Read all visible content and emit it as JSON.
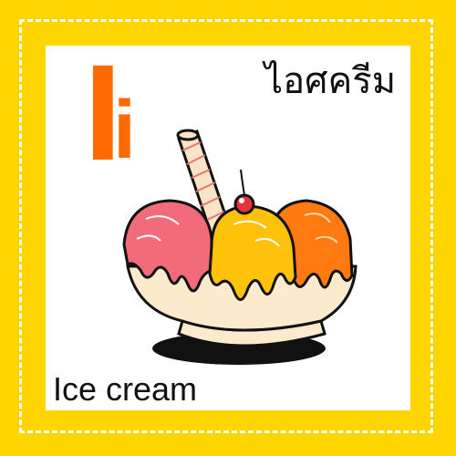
{
  "card": {
    "uppercase": "I",
    "lowercase": "i",
    "thai_word": "ไอศครีม",
    "english_word": "Ice cream"
  },
  "colors": {
    "background": "#ffd500",
    "letter": "#ff6a00",
    "scoop_pink": "#f26b7a",
    "scoop_yellow": "#ffc20a",
    "scoop_orange": "#ff7a10",
    "bowl": "#fbeacc",
    "cherry": "#e8323c"
  },
  "illustration": {
    "icon": "ice-cream-sundae-icon"
  }
}
